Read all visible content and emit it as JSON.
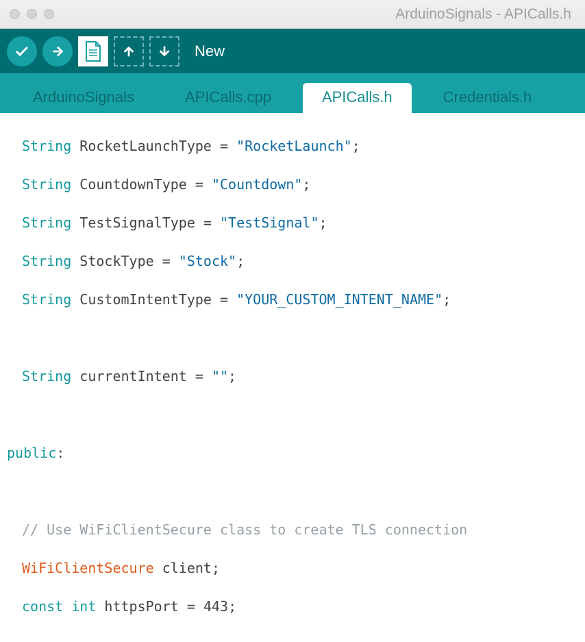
{
  "window": {
    "title": "ArduinoSignals - APICalls.h"
  },
  "toolbar": {
    "label": "New"
  },
  "tabs": [
    {
      "label": "ArduinoSignals",
      "active": false
    },
    {
      "label": "APICalls.cpp",
      "active": false
    },
    {
      "label": "APICalls.h",
      "active": true
    },
    {
      "label": "Credentials.h",
      "active": false
    }
  ],
  "code": {
    "l1": {
      "kw": "String",
      "name": " RocketLaunchType = ",
      "str": "\"RocketLaunch\"",
      "end": ";"
    },
    "l2": {
      "kw": "String",
      "name": " CountdownType = ",
      "str": "\"Countdown\"",
      "end": ";"
    },
    "l3": {
      "kw": "String",
      "name": " TestSignalType = ",
      "str": "\"TestSignal\"",
      "end": ";"
    },
    "l4": {
      "kw": "String",
      "name": " StockType = ",
      "str": "\"Stock\"",
      "end": ";"
    },
    "l5": {
      "kw": "String",
      "name": " CustomIntentType = ",
      "str": "\"YOUR_CUSTOM_INTENT_NAME\"",
      "end": ";"
    },
    "l6": {
      "kw": "String",
      "name": " currentIntent = ",
      "str": "\"\"",
      "end": ";"
    },
    "pub": "public",
    "pubc": ":",
    "comment": "// Use WiFiClientSecure class to create TLS connection",
    "l7": {
      "type": "WiFiClientSecure",
      "name": " client;"
    },
    "l8": {
      "kw1": "const",
      "kw2": " int",
      "name": " httpsPort = ",
      "num": "443",
      "end": ";"
    }
  }
}
